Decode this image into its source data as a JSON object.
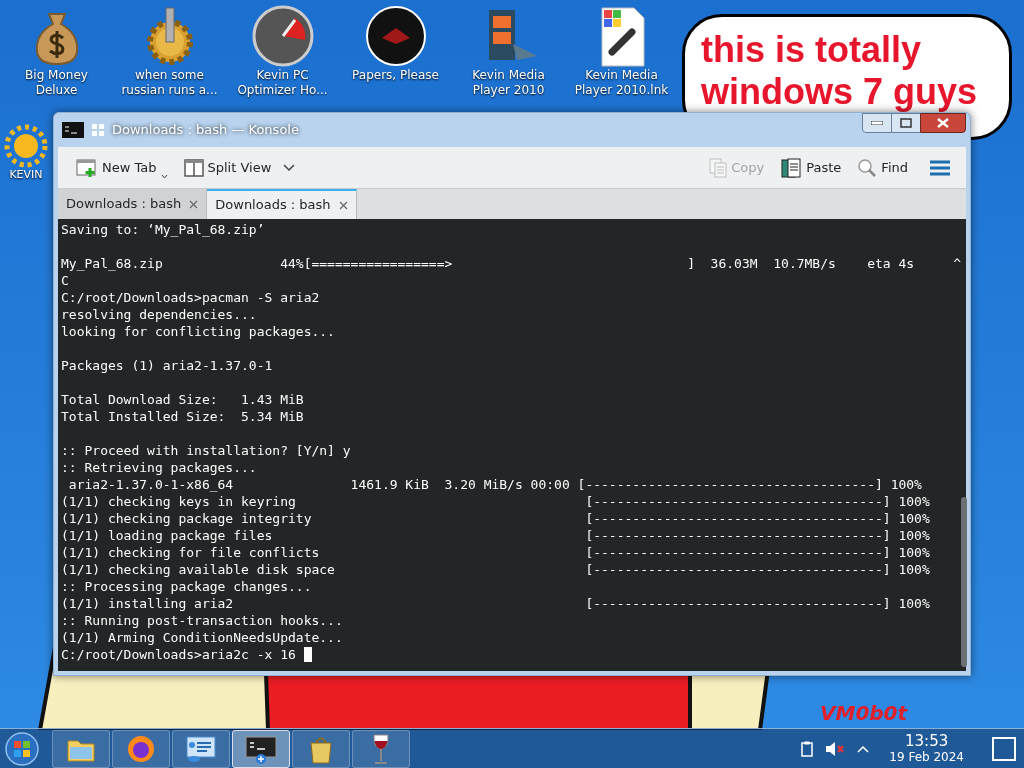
{
  "desktop_icons": [
    {
      "label": "Big Money Deluxe",
      "kind": "moneybag"
    },
    {
      "label": "when some russian runs a...",
      "kind": "gear"
    },
    {
      "label": "Kevin PC Optimizer Ho...",
      "kind": "gauge"
    },
    {
      "label": "Papers, Please",
      "kind": "seal"
    },
    {
      "label": "Kevin Media Player 2010",
      "kind": "film"
    },
    {
      "label": "Kevin Media Player 2010.lnk",
      "kind": "shortcut"
    }
  ],
  "side_icon": {
    "label": "KEVIN"
  },
  "wallpaper": {
    "bubble_lines": [
      "this is totally",
      "windows 7 guys"
    ],
    "signature": "VM0b0t"
  },
  "window": {
    "title": "Downloads : bash — Konsole",
    "toolbar": [
      {
        "label": "New Tab",
        "kind": "newtab",
        "disabled": false
      },
      {
        "label": "Split View",
        "kind": "split",
        "disabled": false
      },
      {
        "label": "Copy",
        "kind": "copy",
        "disabled": true
      },
      {
        "label": "Paste",
        "kind": "paste",
        "disabled": false
      },
      {
        "label": "Find",
        "kind": "find",
        "disabled": false
      }
    ],
    "tabs": [
      {
        "label": "Downloads : bash",
        "selected": false
      },
      {
        "label": "Downloads : bash",
        "selected": true
      }
    ],
    "terminal_lines": [
      {
        "kind": "text",
        "text": "Saving to: ‘My_Pal_68.zip’"
      },
      {
        "kind": "blank"
      },
      {
        "kind": "text",
        "text": "My_Pal_68.zip               44%[=================>                              ]  36.03M  10.7MB/s    eta 4s     ^"
      },
      {
        "kind": "text",
        "text": "C"
      },
      {
        "kind": "text",
        "text": "C:/root/Downloads>pacman -S aria2"
      },
      {
        "kind": "text",
        "text": "resolving dependencies..."
      },
      {
        "kind": "text",
        "text": "looking for conflicting packages..."
      },
      {
        "kind": "blank"
      },
      {
        "kind": "text",
        "text": "Packages (1) aria2-1.37.0-1"
      },
      {
        "kind": "blank"
      },
      {
        "kind": "text",
        "text": "Total Download Size:   1.43 MiB"
      },
      {
        "kind": "text",
        "text": "Total Installed Size:  5.34 MiB"
      },
      {
        "kind": "blank"
      },
      {
        "kind": "text",
        "text": ":: Proceed with installation? [Y/n] y"
      },
      {
        "kind": "text",
        "text": ":: Retrieving packages..."
      },
      {
        "kind": "text",
        "text": " aria2-1.37.0-1-x86_64               1461.9 KiB  3.20 MiB/s 00:00 [-------------------------------------] 100%"
      },
      {
        "kind": "text",
        "text": "(1/1) checking keys in keyring                                     [-------------------------------------] 100%"
      },
      {
        "kind": "text",
        "text": "(1/1) checking package integrity                                   [-------------------------------------] 100%"
      },
      {
        "kind": "text",
        "text": "(1/1) loading package files                                        [-------------------------------------] 100%"
      },
      {
        "kind": "text",
        "text": "(1/1) checking for file conflicts                                  [-------------------------------------] 100%"
      },
      {
        "kind": "text",
        "text": "(1/1) checking available disk space                                [-------------------------------------] 100%"
      },
      {
        "kind": "text",
        "text": ":: Processing package changes..."
      },
      {
        "kind": "text",
        "text": "(1/1) installing aria2                                             [-------------------------------------] 100%"
      },
      {
        "kind": "text",
        "text": ":: Running post-transaction hooks..."
      },
      {
        "kind": "text",
        "text": "(1/1) Arming ConditionNeedsUpdate..."
      },
      {
        "kind": "prompt",
        "text": "C:/root/Downloads>aria2c -x 16",
        "cursor": true
      }
    ]
  },
  "taskbar": {
    "apps": [
      {
        "kind": "folder",
        "active": false
      },
      {
        "kind": "browser",
        "active": false
      },
      {
        "kind": "panel",
        "active": false
      },
      {
        "kind": "terminal",
        "active": true
      },
      {
        "kind": "bag",
        "active": false
      },
      {
        "kind": "wine",
        "active": false
      }
    ],
    "time": "13:53",
    "date": "19 Feb 2024"
  }
}
